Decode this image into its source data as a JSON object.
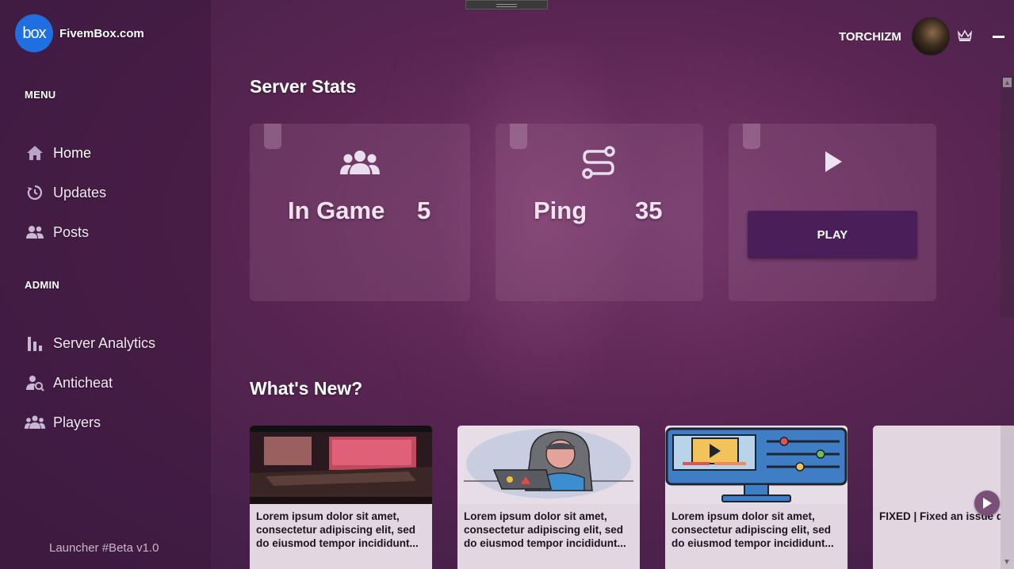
{
  "brand": {
    "logo_mark": "box",
    "name": "FivemBox.com"
  },
  "sidebar": {
    "menu_title": "MENU",
    "menu_items": [
      {
        "label": "Home",
        "icon": "home-icon"
      },
      {
        "label": "Updates",
        "icon": "updates-icon"
      },
      {
        "label": "Posts",
        "icon": "posts-icon"
      }
    ],
    "admin_title": "ADMIN",
    "admin_items": [
      {
        "label": "Server Analytics",
        "icon": "analytics-icon"
      },
      {
        "label": "Anticheat",
        "icon": "anticheat-icon"
      },
      {
        "label": "Players",
        "icon": "players-icon"
      }
    ],
    "version": "Launcher #Beta v1.0"
  },
  "user": {
    "name": "TORCHIZM"
  },
  "stats": {
    "title": "Server Stats",
    "in_game_label": "In Game",
    "in_game_value": "5",
    "ping_label": "Ping",
    "ping_value": "35",
    "play_label": "PLAY"
  },
  "news": {
    "title": "What's New?",
    "cards": [
      {
        "text": "Lorem ipsum dolor sit amet, consectetur adipiscing elit, sed do eiusmod tempor incididunt..."
      },
      {
        "text": "Lorem ipsum dolor sit amet, consectetur adipiscing elit, sed do eiusmod tempor incididunt..."
      },
      {
        "text": "Lorem ipsum dolor sit amet, consectetur adipiscing elit, sed do eiusmod tempor incididunt..."
      },
      {
        "text": "FIXED | Fixed an issue d crash when joining to th"
      }
    ]
  },
  "colors": {
    "accent": "#1f6fe0",
    "play_button": "#4a1e58",
    "background": "#4a2049"
  }
}
